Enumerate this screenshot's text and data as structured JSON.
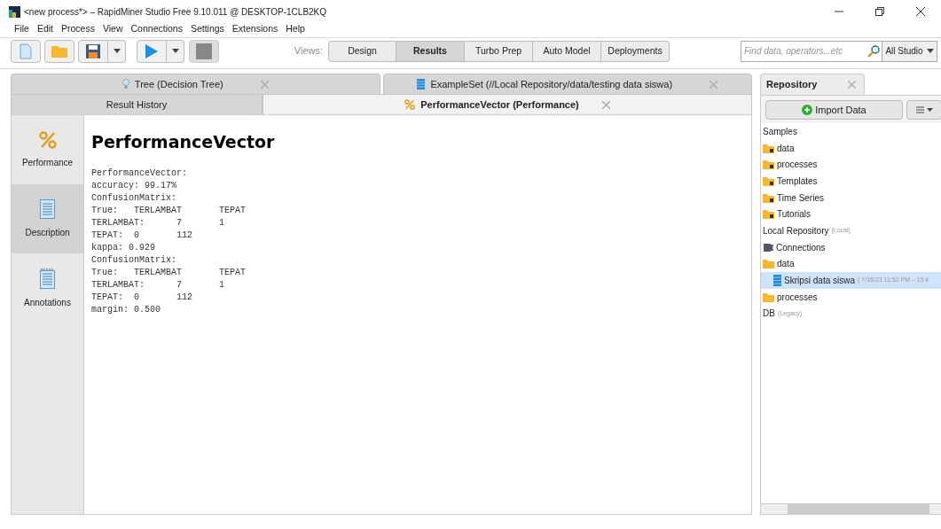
{
  "window": {
    "title": "<new process*> – RapidMiner Studio Free 9.10.011 @ DESKTOP-1CLB2KQ"
  },
  "menu": [
    "File",
    "Edit",
    "Process",
    "View",
    "Connections",
    "Settings",
    "Extensions",
    "Help"
  ],
  "toolbar": {
    "views_label": "Views:",
    "views": [
      {
        "label": "Design",
        "selected": false
      },
      {
        "label": "Results",
        "selected": true
      },
      {
        "label": "Turbo Prep",
        "selected": false
      },
      {
        "label": "Auto Model",
        "selected": false
      },
      {
        "label": "Deployments",
        "selected": false
      }
    ],
    "search": {
      "placeholder": "Find data, operators...etc"
    },
    "scope": "All Studio"
  },
  "result_tabs": [
    {
      "label": "Tree (Decision Tree)",
      "kind": "model",
      "selected": false
    },
    {
      "label": "ExampleSet (//Local Repository/data/testing data siswa)",
      "kind": "data",
      "selected": false
    }
  ],
  "sub_tabs": [
    {
      "label": "Result History",
      "selected": false
    },
    {
      "label": "PerformanceVector (Performance)",
      "selected": true
    }
  ],
  "side_nav": [
    {
      "label": "Performance",
      "kind": "performance",
      "selected": false
    },
    {
      "label": "Description",
      "kind": "description",
      "selected": true
    },
    {
      "label": "Annotations",
      "kind": "annotations",
      "selected": false
    }
  ],
  "content": {
    "heading": "PerformanceVector",
    "lines": [
      "PerformanceVector:",
      "accuracy: 99.17%",
      "ConfusionMatrix:",
      "True:   TERLAMBAT       TEPAT",
      "TERLAMBAT:      7       1",
      "TEPAT:  0       112",
      "kappa: 0.929",
      "ConfusionMatrix:",
      "True:   TERLAMBAT       TEPAT",
      "TERLAMBAT:      7       1",
      "TEPAT:  0       112",
      "margin: 0.500"
    ]
  },
  "repository": {
    "tab": "Repository",
    "import_button": "Import Data",
    "tree": [
      {
        "label": "Samples",
        "selected": false,
        "children": [
          {
            "label": "data",
            "kind": "locked-folder",
            "selected": false
          },
          {
            "label": "processes",
            "kind": "locked-folder",
            "selected": false
          },
          {
            "label": "Templates",
            "kind": "locked-folder",
            "selected": false
          },
          {
            "label": "Time Series",
            "kind": "locked-folder",
            "selected": false
          },
          {
            "label": "Tutorials",
            "kind": "locked-folder",
            "selected": false
          }
        ]
      },
      {
        "label": "Local Repository",
        "note": "(Local)",
        "selected": false,
        "children": [
          {
            "label": "Connections",
            "kind": "connections",
            "selected": false
          },
          {
            "label": "data",
            "kind": "folder",
            "selected": false,
            "children": [
              {
                "label": "Skripsi data siswa",
                "note": "( 7/16/23 11:52 PM – 15 k",
                "kind": "dataset",
                "selected": true
              }
            ]
          },
          {
            "label": "processes",
            "kind": "folder",
            "selected": false
          }
        ]
      },
      {
        "label": "DB",
        "note": "(Legacy)",
        "selected": false
      }
    ]
  }
}
